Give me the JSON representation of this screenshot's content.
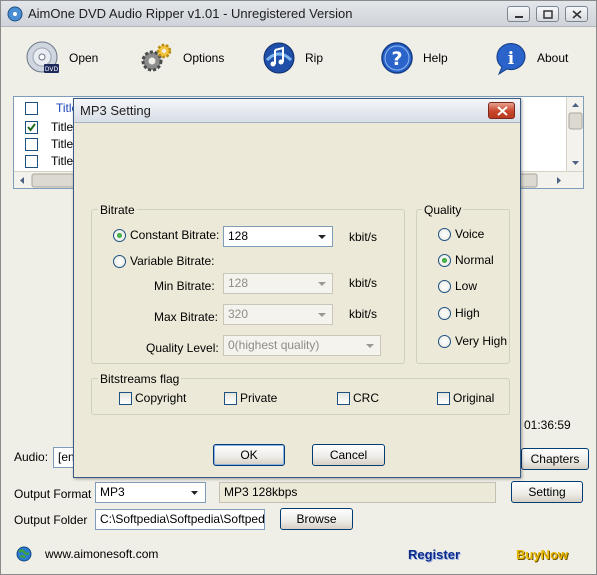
{
  "main": {
    "title": "AimOne DVD Audio Ripper v1.01 - Unregistered Version",
    "toolbar": {
      "open": "Open",
      "options": "Options",
      "rip": "Rip",
      "help": "Help",
      "about": "About"
    },
    "list": {
      "header": "Title",
      "rows": [
        "Title",
        "Title",
        "Title"
      ]
    },
    "duration": "01:36:59",
    "chapters_label": "Chapters",
    "audio_label": "Audio:",
    "audio_value": "[en",
    "output_format_label": "Output Format",
    "output_format_value": "MP3",
    "format_summary": "MP3  128kbps",
    "setting_label": "Setting",
    "output_folder_label": "Output Folder",
    "output_folder_value": "C:\\Softpedia\\Softpedia\\Softpedia",
    "browse_label": "Browse",
    "website": "www.aimonesoft.com",
    "register_label": "Register",
    "buynow_label": "BuyNow",
    "colors": {
      "register": "#0a2a8a",
      "buynow": "#e8b800"
    }
  },
  "dialog": {
    "title": "MP3 Setting",
    "bitrate_group": "Bitrate",
    "constant_label": "Constant Bitrate:",
    "constant_value": "128",
    "variable_label": "Variable Bitrate:",
    "min_label": "Min Bitrate:",
    "min_value": "128",
    "max_label": "Max Bitrate:",
    "max_value": "320",
    "quality_level_label": "Quality Level:",
    "quality_level_value": "0(highest quality)",
    "unit": "kbit/s",
    "quality_group": "Quality",
    "quality_options": [
      "Voice",
      "Normal",
      "Low",
      "High",
      "Very High"
    ],
    "quality_selected": "Normal",
    "bitstreams_group": "Bitstreams flag",
    "flags": [
      "Copyright",
      "Private",
      "CRC",
      "Original"
    ],
    "ok_label": "OK",
    "cancel_label": "Cancel"
  }
}
